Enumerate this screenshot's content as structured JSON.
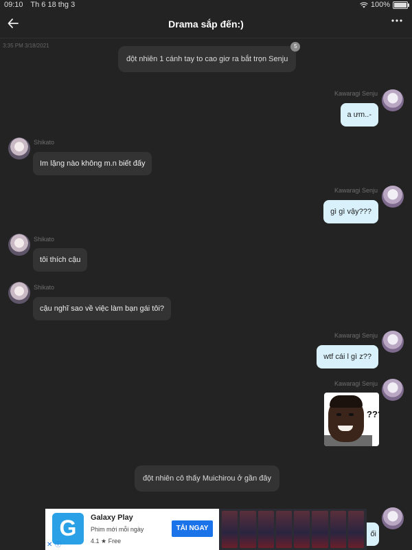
{
  "status_bar": {
    "time": "09:10",
    "date": "Th 6 18 thg 3",
    "battery": "100%"
  },
  "header": {
    "title": "Drama sắp đến:)",
    "back_icon": "arrow-left-icon",
    "more_icon": "more-dots-icon"
  },
  "stamp": "3:35 PM 3/18/2021",
  "messages": [
    {
      "kind": "system",
      "text": "đột nhiên 1 cánh tay to cao giơ ra bắt trọn Senju",
      "badge": "5"
    },
    {
      "kind": "outgoing",
      "sender": "Kawaragi Senju",
      "text": "a ưm..-"
    },
    {
      "kind": "incoming",
      "sender": "Shikato",
      "text": "Im lặng nào không m.n biết đấy"
    },
    {
      "kind": "outgoing",
      "sender": "Kawaragi Senju",
      "text": "gì gì vậy???"
    },
    {
      "kind": "incoming",
      "sender": "Shikato",
      "text": "tôi thích cậu"
    },
    {
      "kind": "incoming",
      "sender": "Shikato",
      "text": "cậu nghĩ sao về việc làm bạn gái tôi?"
    },
    {
      "kind": "outgoing",
      "sender": "Kawaragi Senju",
      "text": "wtf cái l gì z??"
    },
    {
      "kind": "outgoing-image",
      "sender": "Kawaragi Senju",
      "image_text": "???"
    },
    {
      "kind": "system",
      "text": "đột nhiên cô thấy Muichirou ở gần đây"
    },
    {
      "kind": "outgoing",
      "sender": "Kawaragi Senju",
      "text": "ối"
    }
  ],
  "ad": {
    "logo_letter": "G",
    "app_name": "Galaxy Play",
    "tagline": "Phim mới mỗi ngày",
    "rating": "4.1 ★  Free",
    "cta": "TẢI NGAY",
    "close_glyph": "✕",
    "info_glyph": "ⓘ"
  }
}
